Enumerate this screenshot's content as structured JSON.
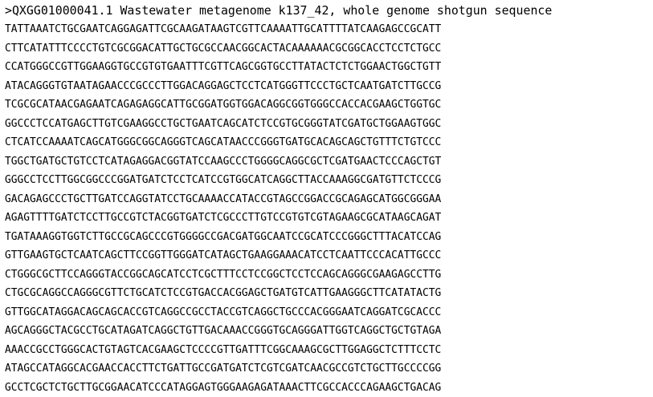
{
  "header": ">QXGG01000041.1 Wastewater metagenome k137_42, whole genome shotgun sequence",
  "sequence_lines": [
    "TATTAAATCTGCGAATCAGGAGATTCGCAAGATAAGTCGTTCAAAATTGCATTTTATCAAGAGCCGCATT",
    "CTTCATATTTCCCCTGTCGCGGACATTGCTGCGCCAACGGCACTACAAAAAACGCGGCACCTCCTCTGCC",
    "CCATGGGCCGTTGGAAGGTGCCGTGTGAATTTCGTTCAGCGGTGCCTTATACTCTCTGGAACTGGCTGTT",
    "ATACAGGGTGTAATAGAACCCGCCCTTGGACAGGAGCTCCTCATGGGTTCCCTGCTCAATGATCTTGCCG",
    "TCGCGCATAACGAGAATCAGAGAGGCATTGCGGATGGTGGACAGGCGGTGGGCCACCACGAAGCTGGTGC",
    "GGCCCTCCATGAGCTTGTCGAAGGCCTGCTGAATCAGCATCTCCGTGCGGGTATCGATGCTGGAAGTGGC",
    "CTCATCCAAAATCAGCATGGGCGGCAGGGTCAGCATAACCCGGGTGATGCACAGCAGCTGTTTCTGTCCC",
    "TGGCTGATGCTGTCCTCATAGAGGACGGTATCCAAGCCCTGGGGCAGGCGCTCGATGAACTCCCAGCTGT",
    "GGGCCTCCTTGGCGGCCCGGATGATCTCCTCATCCGTGGCATCAGGCTTACCAAAGGCGATGTTCTCCCG",
    "GACAGAGCCCTGCTTGATCCAGGTATCCTGCAAAACCATACCGTAGCCGGACCGCAGAGCATGGCGGGAA",
    "AGAGTTTTGATCTCCTTGCCGTCTACGGTGATCTCGCCCTTGTCCGTGTCGTAGAAGCGCATAAGCAGAT",
    "TGATAAAGGTGGTCTTGCCGCAGCCCGTGGGGCCGACGATGGCAATCCGCATCCCGGGCTTTACATCCAG",
    "GTTGAAGTGCTCAATCAGCTTCCGGTTGGGATCATAGCTGAAGGAAACATCCTCAATTCCCACATTGCCC",
    "CTGGGCGCTTCCAGGGTACCGGCAGCATCCTCGCTTTCCTCCGGCTCCTCCAGCAGGGCGAAGAGCCTTG",
    "CTGCGCAGGCCAGGGCGTTCTGCATCTCCGTGACCACGGAGCTGATGTCATTGAAGGGCTTCATATACTG",
    "GTTGGCATAGGACAGCAGCACCGTCAGGCCGCCTACCGTCAGGCTGCCCACGGGAATCAGGATCGCACCC",
    "AGCAGGGCTACGCCTGCATAGATCAGGCTGTTGACAAACCGGGTGCAGGGATTGGTCAGGCTGCTGTAGA",
    "AAACCGCCTGGGCACTGTAGTCACGAAGCTCCCCGTTGATTTCGGCAAAGCGCTTGGAGGCTCTTTCCTC",
    "ATAGCCATAGGCACGAACCACCTTCTGATTGCCGATGATCTCGTCGATCAACGCCGTCTGCTTGCCCCGG",
    "GCCTCGCTCTGCTTGCGGAACATCCCATAGGAGTGGGAAGAGATAAACTTCGCCACCCAGAAGCTGACAG"
  ]
}
